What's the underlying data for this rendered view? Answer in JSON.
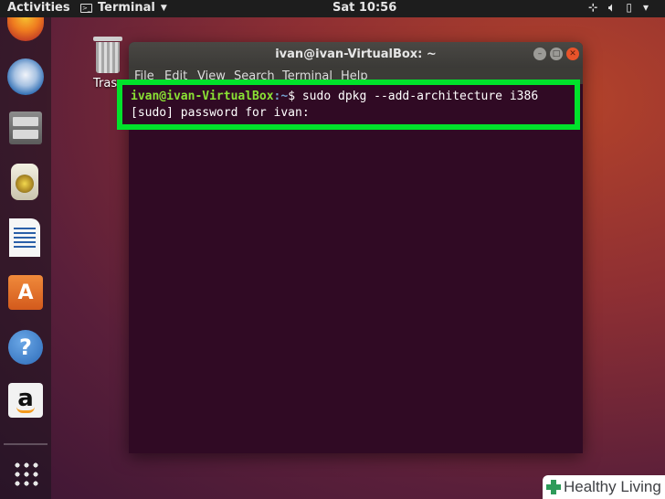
{
  "topbar": {
    "activities": "Activities",
    "app_name": "Terminal",
    "clock": "Sat 10:56",
    "tray_icons": [
      "network-icon",
      "volume-icon",
      "battery-icon",
      "power-menu-icon"
    ]
  },
  "dock": {
    "items": [
      "Firefox",
      "Thunderbird",
      "Files",
      "Rhythmbox",
      "LibreOffice Writer",
      "Ubuntu Software",
      "Help",
      "Amazon"
    ],
    "amazon_glyph": "a",
    "help_glyph": "?",
    "software_glyph": "A"
  },
  "desktop": {
    "trash_label": "Tras"
  },
  "terminal": {
    "title": "ivan@ivan-VirtualBox: ~",
    "menu": [
      "File",
      "Edit",
      "View",
      "Search",
      "Terminal",
      "Help"
    ],
    "prompt_user": "ivan@ivan-VirtualBox",
    "prompt_path": ":~",
    "prompt_symbol": "$ ",
    "command": "sudo dpkg --add-architecture i386",
    "password_prompt": "[sudo] password for ivan:",
    "colors": {
      "background": "#300a24",
      "user": "#8ae234",
      "highlight": "#00e22b"
    }
  },
  "watermark": {
    "text": "Healthy Living"
  }
}
